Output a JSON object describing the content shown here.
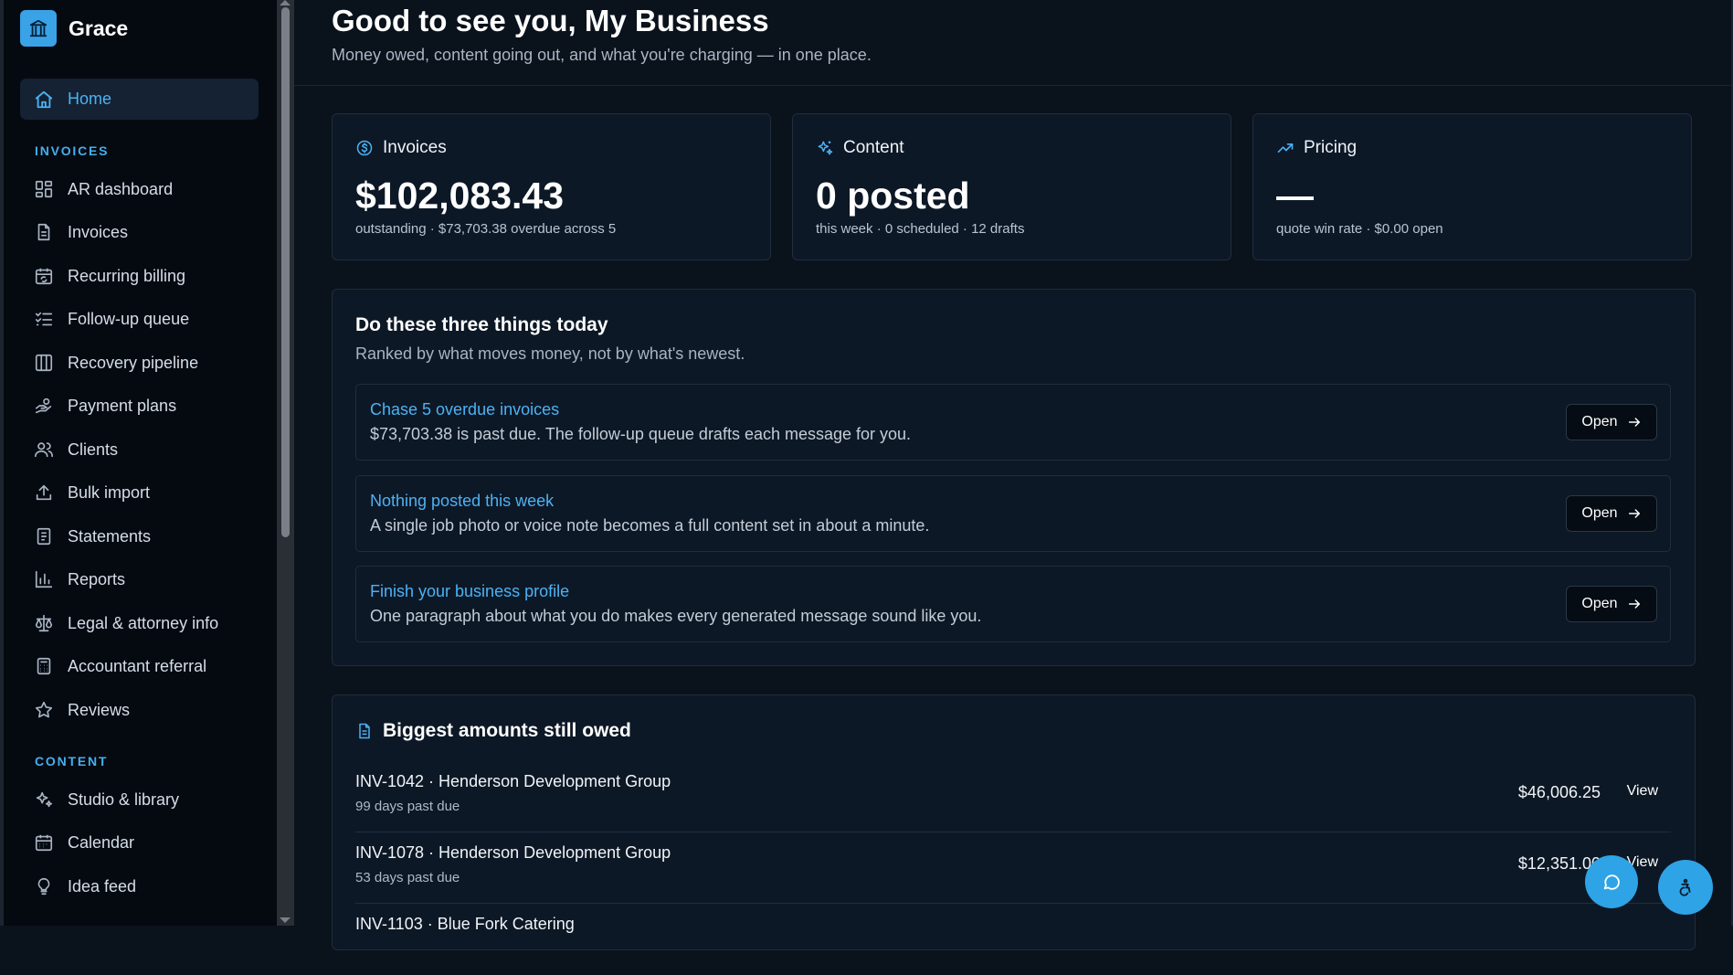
{
  "brand": {
    "name": "Grace",
    "logo_icon": "bank-icon"
  },
  "sidebar": {
    "home": {
      "label": "Home",
      "icon": "home-icon"
    },
    "sections": [
      {
        "label": "INVOICES",
        "items": [
          {
            "label": "AR dashboard",
            "icon": "dashboard-icon"
          },
          {
            "label": "Invoices",
            "icon": "file-text-icon"
          },
          {
            "label": "Recurring billing",
            "icon": "calendar-sync-icon"
          },
          {
            "label": "Follow-up queue",
            "icon": "list-checks-icon"
          },
          {
            "label": "Recovery pipeline",
            "icon": "columns-icon"
          },
          {
            "label": "Payment plans",
            "icon": "hand-coins-icon"
          },
          {
            "label": "Clients",
            "icon": "users-icon"
          },
          {
            "label": "Bulk import",
            "icon": "upload-icon"
          },
          {
            "label": "Statements",
            "icon": "statement-icon"
          },
          {
            "label": "Reports",
            "icon": "bar-chart-icon"
          },
          {
            "label": "Legal & attorney info",
            "icon": "scale-icon"
          },
          {
            "label": "Accountant referral",
            "icon": "calculator-icon"
          },
          {
            "label": "Reviews",
            "icon": "star-icon"
          }
        ]
      },
      {
        "label": "CONTENT",
        "items": [
          {
            "label": "Studio & library",
            "icon": "sparkles-icon"
          },
          {
            "label": "Calendar",
            "icon": "calendar-icon"
          },
          {
            "label": "Idea feed",
            "icon": "lightbulb-icon"
          }
        ]
      }
    ]
  },
  "header": {
    "greeting": "Good to see you, My Business",
    "subtitle": "Money owed, content going out, and what you're charging — in one place."
  },
  "cards": [
    {
      "title": "Invoices",
      "icon": "dollar-circle-icon",
      "value": "$102,083.43",
      "sub": "outstanding · $73,703.38 overdue across 5"
    },
    {
      "title": "Content",
      "icon": "sparkles-icon",
      "value": "0 posted",
      "sub": "this week · 0 scheduled · 12 drafts"
    },
    {
      "title": "Pricing",
      "icon": "trending-up-icon",
      "value": "—",
      "sub": "quote win rate · $0.00 open"
    }
  ],
  "today": {
    "title": "Do these three things today",
    "subtitle": "Ranked by what moves money, not by what's newest.",
    "tasks": [
      {
        "title": "Chase 5 overdue invoices",
        "desc": "$73,703.38 is past due. The follow-up queue drafts each message for you.",
        "button": "Open"
      },
      {
        "title": "Nothing posted this week",
        "desc": "A single job photo or voice note becomes a full content set in about a minute.",
        "button": "Open"
      },
      {
        "title": "Finish your business profile",
        "desc": "One paragraph about what you do makes every generated message sound like you.",
        "button": "Open"
      }
    ]
  },
  "owed": {
    "title": "Biggest amounts still owed",
    "rows": [
      {
        "name": "INV-1042 · Henderson Development Group",
        "days": "99 days past due",
        "amount": "$46,006.25",
        "action": "View"
      },
      {
        "name": "INV-1078 · Henderson Development Group",
        "days": "53 days past due",
        "amount": "$12,351.00",
        "action": "View"
      },
      {
        "name": "INV-1103 · Blue Fork Catering",
        "days": "",
        "amount": "",
        "action": ""
      }
    ]
  },
  "fabs": {
    "chat_icon": "chat-icon",
    "accessibility_icon": "accessibility-icon"
  },
  "colors": {
    "accent": "#3aa2e6",
    "link": "#4cb2f4",
    "background": "#0a121c",
    "card": "#0d1826"
  }
}
